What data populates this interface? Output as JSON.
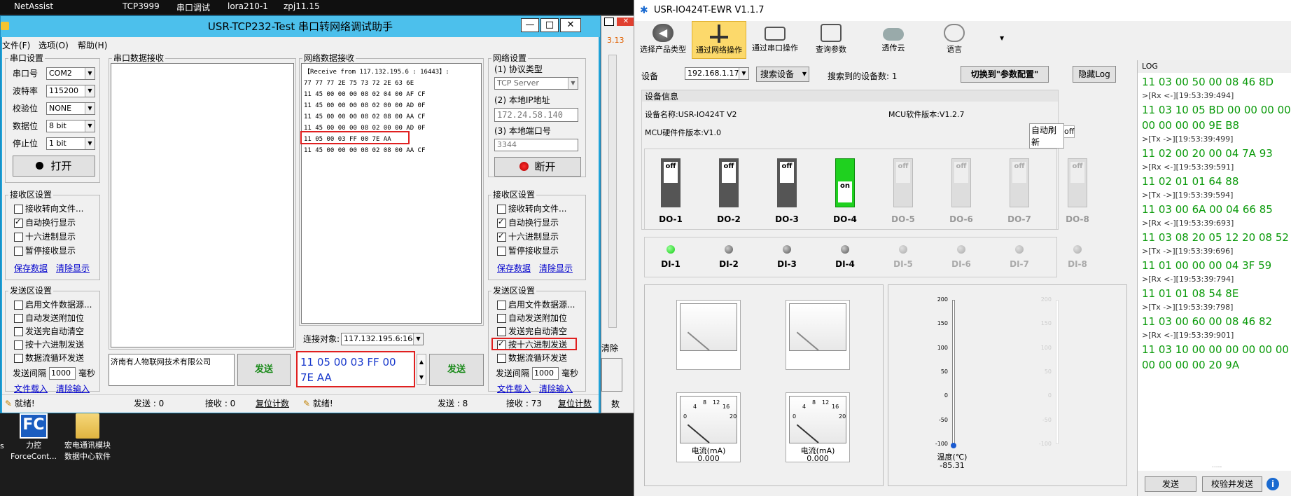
{
  "taskbar": {
    "items": [
      "NetAssist",
      "TCP3999",
      "串口调试",
      "lora210-1",
      "zpj11.15"
    ]
  },
  "desktop": {
    "icons": [
      {
        "label1": "力控",
        "label2": "ForceCont..."
      },
      {
        "label1": "宏电通讯模块",
        "label2": "数据中心软件"
      }
    ],
    "partial": "s"
  },
  "tcp": {
    "title": "USR-TCP232-Test 串口转网络调试助手",
    "menu": [
      "文件(F)",
      "选项(O)",
      "帮助(H)"
    ],
    "serial": {
      "caption": "串口设置",
      "port_lbl": "串口号",
      "port": "COM2",
      "baud_lbl": "波特率",
      "baud": "115200",
      "parity_lbl": "校验位",
      "parity": "NONE",
      "data_lbl": "数据位",
      "data": "8 bit",
      "stop_lbl": "停止位",
      "stop": "1 bit",
      "open": "打开"
    },
    "serial_recv": {
      "caption": "接收区设置",
      "opts": [
        "接收转向文件...",
        "自动换行显示",
        "十六进制显示",
        "暂停接收显示"
      ],
      "save": "保存数据",
      "clear": "清除显示"
    },
    "serial_send": {
      "caption": "发送区设置",
      "opts": [
        "启用文件数据源...",
        "自动发送附加位",
        "发送完自动清空",
        "按十六进制发送",
        "数据流循环发送"
      ],
      "interval_lbl": "发送间隔",
      "interval": "1000",
      "unit": "毫秒",
      "load": "文件载入",
      "clear": "清除输入"
    },
    "serial_data_caption": "串口数据接收",
    "serial_send_text": "济南有人物联网技术有限公司",
    "send": "发送",
    "status_left": {
      "ready": "就绪!",
      "sent": "发送 : 0",
      "recv": "接收 : 0",
      "reset": "复位计数"
    },
    "net_data_caption": "网络数据接收",
    "net_lines": [
      "【Receive from 117.132.195.6 : 16443】:",
      "77 77 77 2E 75 73 72 2E 63 6E",
      "11 45 00 00 00 08 02 04 00 AF CF",
      "11 45 00 00 00 08 02 00 00 AD 0F",
      "11 45 00 00 00 08 02 08 00 AA CF",
      "11 45 00 00 00 08 02 00 00 AD 0F",
      "11 05 00 03 FF 00 7E AA",
      "11 45 00 00 00 08 02 08 00 AA CF"
    ],
    "conn_lbl": "连接对象:",
    "conn": "117.132.195.6:1644",
    "net_send_text": "11 05 00 03 FF 00 7E AA",
    "net": {
      "caption": "网络设置",
      "proto_lbl": "(1) 协议类型",
      "proto": "TCP Server",
      "ip_lbl": "(2) 本地IP地址",
      "ip": "172.24.58.140",
      "port_lbl": "(3) 本地端口号",
      "port": "3344",
      "disconnect": "断开"
    },
    "net_recv": {
      "caption": "接收区设置",
      "opts": [
        "接收转向文件...",
        "自动换行显示",
        "十六进制显示",
        "暂停接收显示"
      ],
      "save": "保存数据",
      "clear": "清除显示"
    },
    "net_send": {
      "caption": "发送区设置",
      "opts": [
        "启用文件数据源...",
        "自动发送附加位",
        "发送完自动清空",
        "按十六进制发送",
        "数据流循环发送"
      ],
      "interval_lbl": "发送间隔",
      "interval": "1000",
      "unit": "毫秒",
      "load": "文件载入",
      "clear": "清除输入"
    },
    "status_right": {
      "ready": "就绪!",
      "sent": "发送 : 8",
      "recv": "接收 : 73",
      "reset": "复位计数"
    },
    "behind": {
      "val": "3.13",
      "clear": "清除",
      "tail": "数"
    }
  },
  "usr": {
    "title": "USR-IO424T-EWR V1.1.7",
    "toolbar": [
      "选择产品类型",
      "通过网络操作",
      "通过串口操作",
      "查询参数",
      "透传云",
      "语言"
    ],
    "device_lbl": "设备",
    "device_ip": "192.168.1.177",
    "search": "搜索设备",
    "found": "搜索到的设备数: 1",
    "switch": "切换到\"参数配置\"",
    "hidelog": "隐藏Log",
    "info_caption": "设备信息",
    "name": "设备名称:USR-IO424T V2",
    "fw": "MCU软件版本:V1.2.7",
    "hw": "MCU硬件件版本:V1.0",
    "autorefresh": "自动刷新",
    "off": "off",
    "do": [
      {
        "n": "DO-1",
        "s": "off"
      },
      {
        "n": "DO-2",
        "s": "off"
      },
      {
        "n": "DO-3",
        "s": "off"
      },
      {
        "n": "DO-4",
        "s": "on"
      },
      {
        "n": "DO-5",
        "s": "off"
      },
      {
        "n": "DO-6",
        "s": "off"
      },
      {
        "n": "DO-7",
        "s": "off"
      },
      {
        "n": "DO-8",
        "s": "off"
      }
    ],
    "di": [
      "DI-1",
      "DI-2",
      "DI-3",
      "DI-4",
      "DI-5",
      "DI-6",
      "DI-7",
      "DI-8"
    ],
    "gauge_ticks": [
      "4",
      "8",
      "12",
      "16",
      "20",
      "0"
    ],
    "gauges": [
      {
        "lbl": "电流(mA)",
        "val": "0.000"
      },
      {
        "lbl": "电流(mA)",
        "val": "0.000"
      }
    ],
    "thermo": {
      "ticks": [
        "200",
        "150",
        "100",
        "50",
        "0",
        "-50",
        "-100"
      ],
      "lbl": "温度(℃)",
      "val": "-85.31"
    },
    "log_caption": "LOG",
    "log": [
      {
        "t": "h",
        "v": "11 03 00 50 00 08 46 8D"
      },
      {
        "t": "s",
        "v": ">[Rx <-][19:53:39:494]"
      },
      {
        "t": "h",
        "v": "11 03 10 05 BD 00 00 00 00 0"
      },
      {
        "t": "h",
        "v": "00 00 00 00 9E B8"
      },
      {
        "t": "s",
        "v": ">[Tx ->][19:53:39:499]"
      },
      {
        "t": "h",
        "v": "11 02 00 20 00 04 7A 93"
      },
      {
        "t": "s",
        "v": ">[Rx <-][19:53:39:591]"
      },
      {
        "t": "h",
        "v": "11 02 01 01 64 88"
      },
      {
        "t": "s",
        "v": ">[Tx ->][19:53:39:594]"
      },
      {
        "t": "h",
        "v": "11 03 00 6A 00 04 66 85"
      },
      {
        "t": "s",
        "v": ">[Rx <-][19:53:39:693]"
      },
      {
        "t": "h",
        "v": "11 03 08 20 05 12 20 08 52 0"
      },
      {
        "t": "s",
        "v": ">[Tx ->][19:53:39:696]"
      },
      {
        "t": "h",
        "v": "11 01 00 00 00 04 3F 59"
      },
      {
        "t": "s",
        "v": ">[Rx <-][19:53:39:794]"
      },
      {
        "t": "h",
        "v": "11 01 01 08 54 8E"
      },
      {
        "t": "s",
        "v": ">[Tx ->][19:53:39:798]"
      },
      {
        "t": "h",
        "v": "11 03 00 60 00 08 46 82"
      },
      {
        "t": "s",
        "v": ">[Rx <-][19:53:39:901]"
      },
      {
        "t": "h",
        "v": "11 03 10 00 00 00 00 00 00 0"
      },
      {
        "t": "h",
        "v": "00 00 00 00 20 9A"
      }
    ],
    "send": "发送",
    "checksend": "校验并发送"
  }
}
